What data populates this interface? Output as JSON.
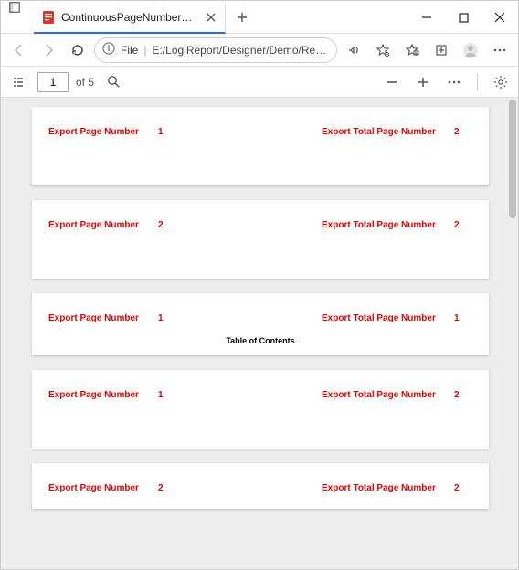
{
  "titlebar": {
    "tab_title": "ContinuousPageNumberWithTO"
  },
  "addrbar": {
    "file_label": "File",
    "url": "E:/LogiReport/Designer/Demo/Reports/TutorialR..."
  },
  "viewer": {
    "current_page": "1",
    "page_count_label": "of 5"
  },
  "pages": [
    {
      "left_label": "Export Page Number",
      "left_val": "1",
      "right_label": "Export Total Page Number",
      "right_val": "2",
      "toc": null
    },
    {
      "left_label": "Export Page Number",
      "left_val": "2",
      "right_label": "Export Total Page Number",
      "right_val": "2",
      "toc": null
    },
    {
      "left_label": "Export Page Number",
      "left_val": "1",
      "right_label": "Export Total Page Number",
      "right_val": "1",
      "toc": "Table of Contents"
    },
    {
      "left_label": "Export Page Number",
      "left_val": "1",
      "right_label": "Export Total Page Number",
      "right_val": "2",
      "toc": null
    },
    {
      "left_label": "Export Page Number",
      "left_val": "2",
      "right_label": "Export Total Page Number",
      "right_val": "2",
      "toc": null
    }
  ]
}
